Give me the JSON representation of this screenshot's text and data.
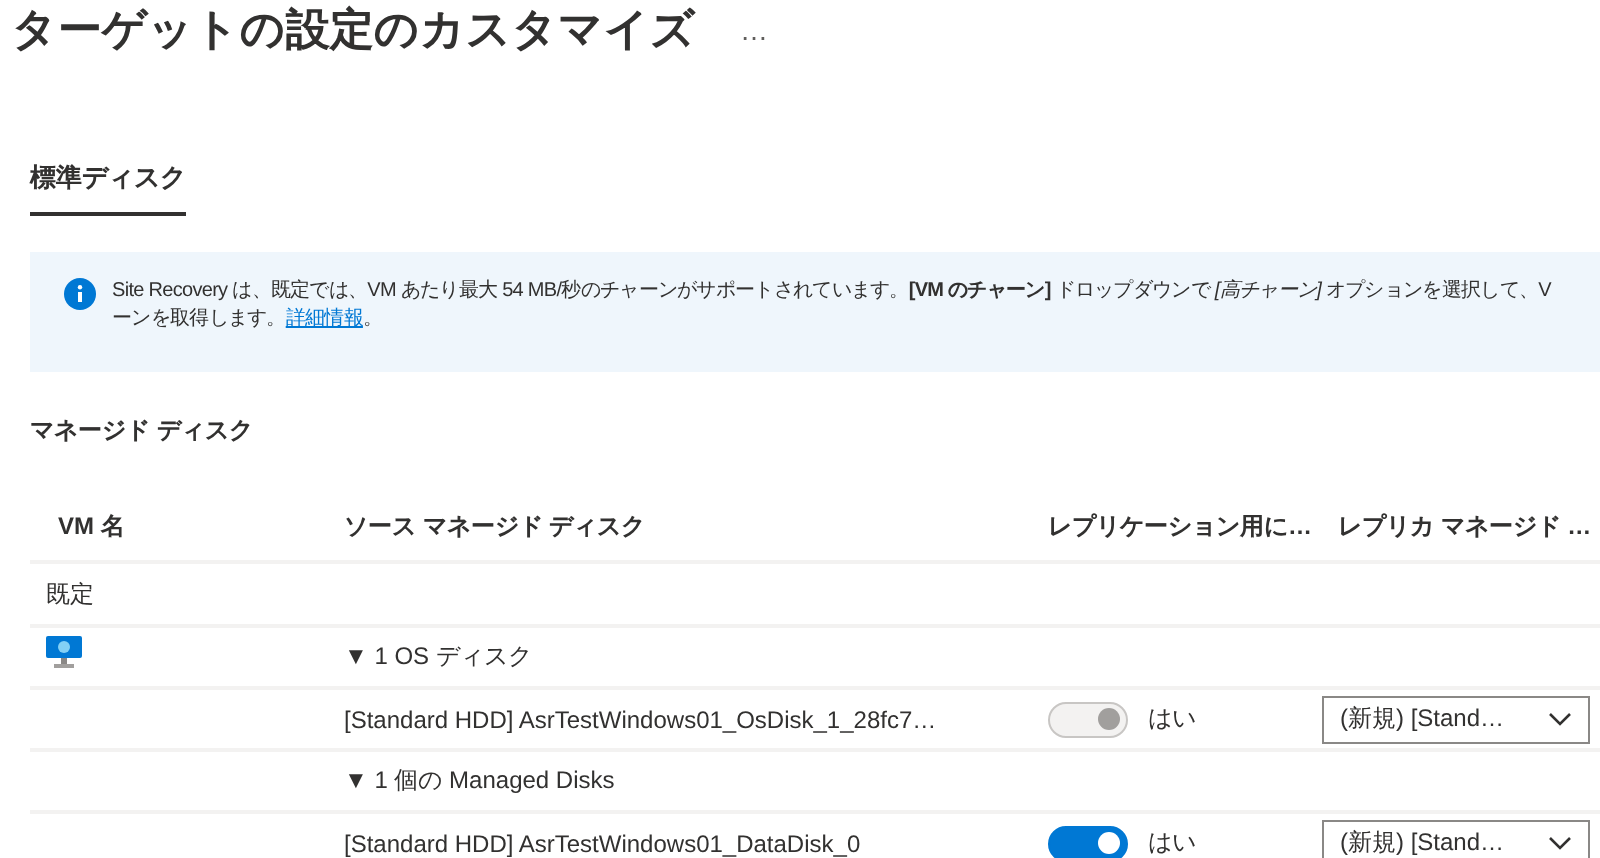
{
  "page": {
    "title": "ターゲットの設定のカスタマイズ",
    "more": "…"
  },
  "tabs": [
    {
      "label": "標準ディスク",
      "selected": true
    }
  ],
  "info": {
    "lines": [
      "Site Recovery は、既定では、VM あたり最大 54 MB/秒のチャーンがサポートされています。**[VM のチャーン]** ドロップダウンで *[高チャーン]* オプションを選択して、V",
      "ーンを取得します。"
    ],
    "link": "詳細情報",
    "tail": "。"
  },
  "section": {
    "title": "マネージド ディスク"
  },
  "table": {
    "columns": [
      "VM 名",
      "ソース マネージド ディスク",
      "レプリケーション用に…",
      "レプリカ マネージド …"
    ],
    "rows": [
      {
        "kind": "label",
        "text": "既定"
      },
      {
        "kind": "group",
        "vm_icon": true,
        "text": "▼ 1 OS ディスク"
      },
      {
        "kind": "disk",
        "text": "[Standard HDD] AsrTestWindows01_OsDisk_1_28fc7…",
        "toggle": {
          "on": true,
          "disabled": true,
          "label": "はい"
        },
        "dropdown": "(新規) [Stand…"
      },
      {
        "kind": "group",
        "vm_icon": false,
        "text": "▼ 1 個の Managed Disks"
      },
      {
        "kind": "disk",
        "text": "[Standard HDD] AsrTestWindows01_DataDisk_0",
        "toggle": {
          "on": true,
          "disabled": false,
          "label": "はい"
        },
        "dropdown": "(新規) [Stand…"
      }
    ]
  }
}
